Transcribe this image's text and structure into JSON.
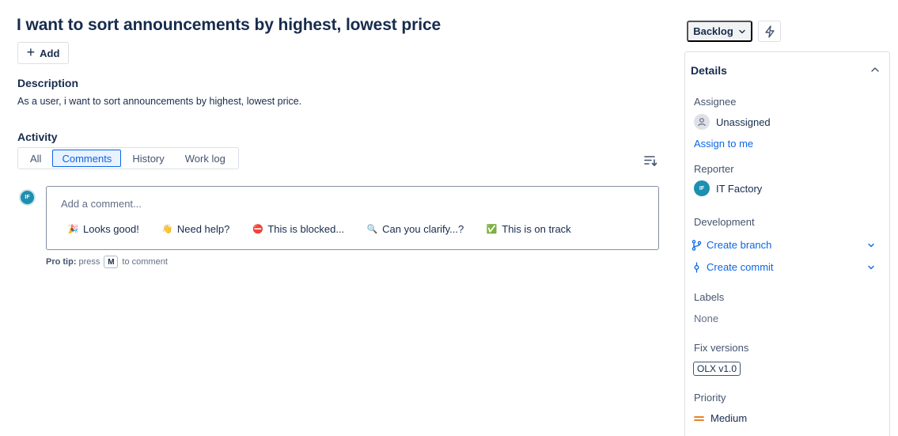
{
  "issue": {
    "title": "I want to sort announcements by highest, lowest price",
    "add_label": "Add",
    "description_heading": "Description",
    "description_text": "As a user, i want to sort announcements by highest, lowest price."
  },
  "activity": {
    "heading": "Activity",
    "tabs": [
      "All",
      "Comments",
      "History",
      "Work log"
    ],
    "active_tab": "Comments",
    "avatar_initials": "IF",
    "comment_placeholder": "Add a comment...",
    "quick_replies": [
      {
        "icon": "party-popper-icon",
        "emoji": "🎉",
        "label": "Looks good!"
      },
      {
        "icon": "waving-hand-icon",
        "emoji": "👋",
        "label": "Need help?"
      },
      {
        "icon": "no-entry-icon",
        "emoji": "⛔",
        "label": "This is blocked..."
      },
      {
        "icon": "magnifier-icon",
        "emoji": "🔍",
        "label": "Can you clarify...?"
      },
      {
        "icon": "check-mark-icon",
        "emoji": "✅",
        "label": "This is on track"
      }
    ],
    "pro_tip_label": "Pro tip:",
    "pro_tip_press": "press",
    "pro_tip_key": "M",
    "pro_tip_suffix": "to comment"
  },
  "sidebar": {
    "status_label": "Backlog",
    "details_heading": "Details",
    "assignee_label": "Assignee",
    "assignee_value": "Unassigned",
    "assign_to_me": "Assign to me",
    "reporter_label": "Reporter",
    "reporter_initials": "IF",
    "reporter_value": "IT Factory",
    "development_label": "Development",
    "create_branch": "Create branch",
    "create_commit": "Create commit",
    "labels_label": "Labels",
    "labels_value": "None",
    "fix_versions_label": "Fix versions",
    "fix_version_value": "OLX v1.0",
    "priority_label": "Priority",
    "priority_value": "Medium"
  },
  "colors": {
    "accent": "#0c66e4",
    "avatar": "#1d8fb0",
    "priority_medium": "#e2740f",
    "text": "#172b4d"
  }
}
